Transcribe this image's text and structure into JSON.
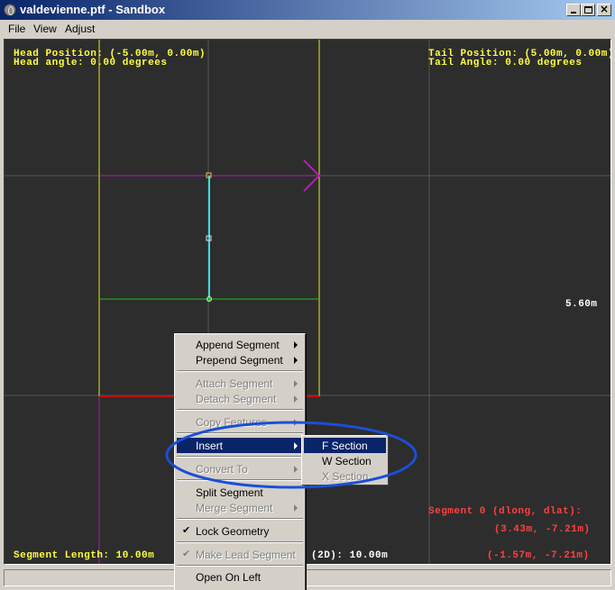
{
  "window": {
    "title": "valdevienne.ptf - Sandbox"
  },
  "menubar": {
    "file": "File",
    "view": "View",
    "adjust": "Adjust"
  },
  "overlay": {
    "head_position": "Head Position: (-5.00m, 0.00m)",
    "head_angle": "Head angle: 0.00 degrees",
    "tail_position": "Tail Position: (5.00m, 0.00m)",
    "tail_angle": "Tail Angle: 0.00 degrees",
    "width_label": "5.60m",
    "segment_header": "Segment 0 (dlong, dlat):",
    "segment_value1": "(3.43m, -7.21m)",
    "segment_value2": "(-1.57m, -7.21m)",
    "segment_length": "Segment Length: 10.00m",
    "length_2d": "(2D): 10.00m"
  },
  "context_menu": {
    "items": [
      {
        "label": "Append Segment",
        "submenu": true,
        "disabled": false
      },
      {
        "label": "Prepend Segment",
        "submenu": true,
        "disabled": false
      },
      {
        "label": "Attach Segment",
        "submenu": true,
        "disabled": true
      },
      {
        "label": "Detach Segment",
        "submenu": true,
        "disabled": true
      },
      {
        "label": "Copy Features",
        "submenu": true,
        "disabled": true
      },
      {
        "label": "Insert",
        "submenu": true,
        "disabled": false,
        "highlighted": true
      },
      {
        "label": "Convert To",
        "submenu": true,
        "disabled": true
      },
      {
        "label": "Split Segment",
        "submenu": false,
        "disabled": false
      },
      {
        "label": "Merge Segment",
        "submenu": true,
        "disabled": true
      },
      {
        "label": "Lock Geometry",
        "submenu": false,
        "disabled": false,
        "checked": true
      },
      {
        "label": "Make Lead Segment",
        "submenu": false,
        "disabled": true,
        "checked": true
      },
      {
        "label": "Open On Left",
        "submenu": false,
        "disabled": false
      }
    ]
  },
  "submenu": {
    "items": [
      {
        "label": "F Section",
        "disabled": false,
        "highlighted": true
      },
      {
        "label": "W Section",
        "disabled": false
      },
      {
        "label": "X Section",
        "disabled": true
      }
    ]
  },
  "colors": {
    "canvas_bg": "#2d2d2d",
    "overlay_yellow": "#ffff40",
    "overlay_red": "#ff4040",
    "selection": "#0a246a",
    "annotation_ring": "#1a4fd6"
  }
}
